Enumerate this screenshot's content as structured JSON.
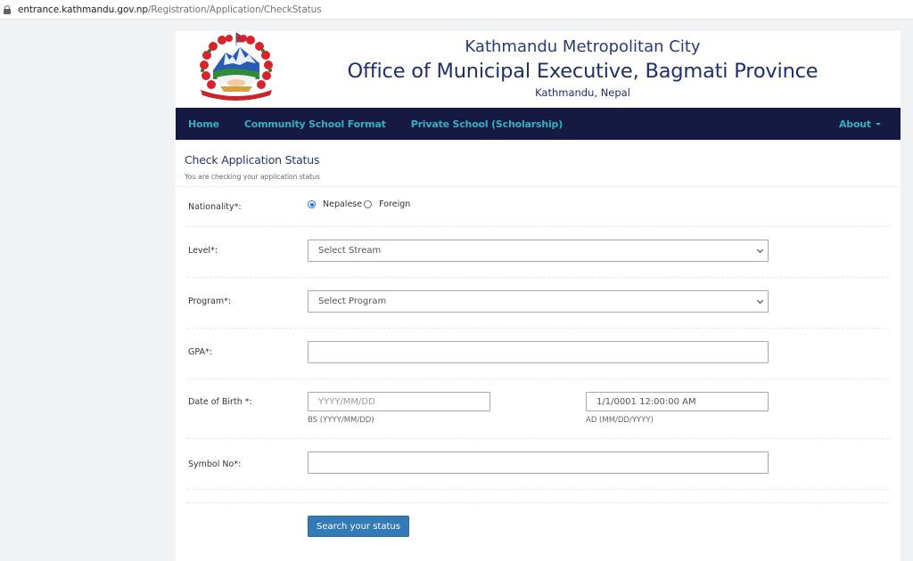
{
  "browser": {
    "url_host": "entrance.kathmandu.gov.np",
    "url_path": "/Registration/Application/CheckStatus"
  },
  "header": {
    "city": "Kathmandu Metropolitan City",
    "office": "Office of Municipal Executive, Bagmati Province",
    "location": "Kathmandu, Nepal",
    "emblem": "nepal-emblem-icon"
  },
  "nav": {
    "items": [
      {
        "label": "Home"
      },
      {
        "label": "Community School Format"
      },
      {
        "label": "Private School (Scholarship)"
      }
    ],
    "about": "About"
  },
  "card": {
    "title": "Check Application Status",
    "subtitle": "You are checking your application status"
  },
  "form": {
    "nationality": {
      "label": "Nationality*:",
      "options": [
        {
          "label": "Nepalese",
          "checked": true
        },
        {
          "label": "Foreign",
          "checked": false
        }
      ]
    },
    "level": {
      "label": "Level*:",
      "selected": "Select Stream"
    },
    "program": {
      "label": "Program*:",
      "selected": "Select Program"
    },
    "gpa": {
      "label": "GPA*:",
      "value": "",
      "placeholder": ""
    },
    "dob": {
      "label": "Date of Birth *:",
      "bs_placeholder": "YYYY/MM/DD",
      "bs_value": "",
      "bs_hint": "BS (YYYY/MM/DD)",
      "ad_value": "1/1/0001 12:00:00 AM",
      "ad_hint": "AD (MM/DD/YYYY)"
    },
    "symbol": {
      "label": "Symbol No*:",
      "value": ""
    },
    "submit": "Search your status"
  }
}
